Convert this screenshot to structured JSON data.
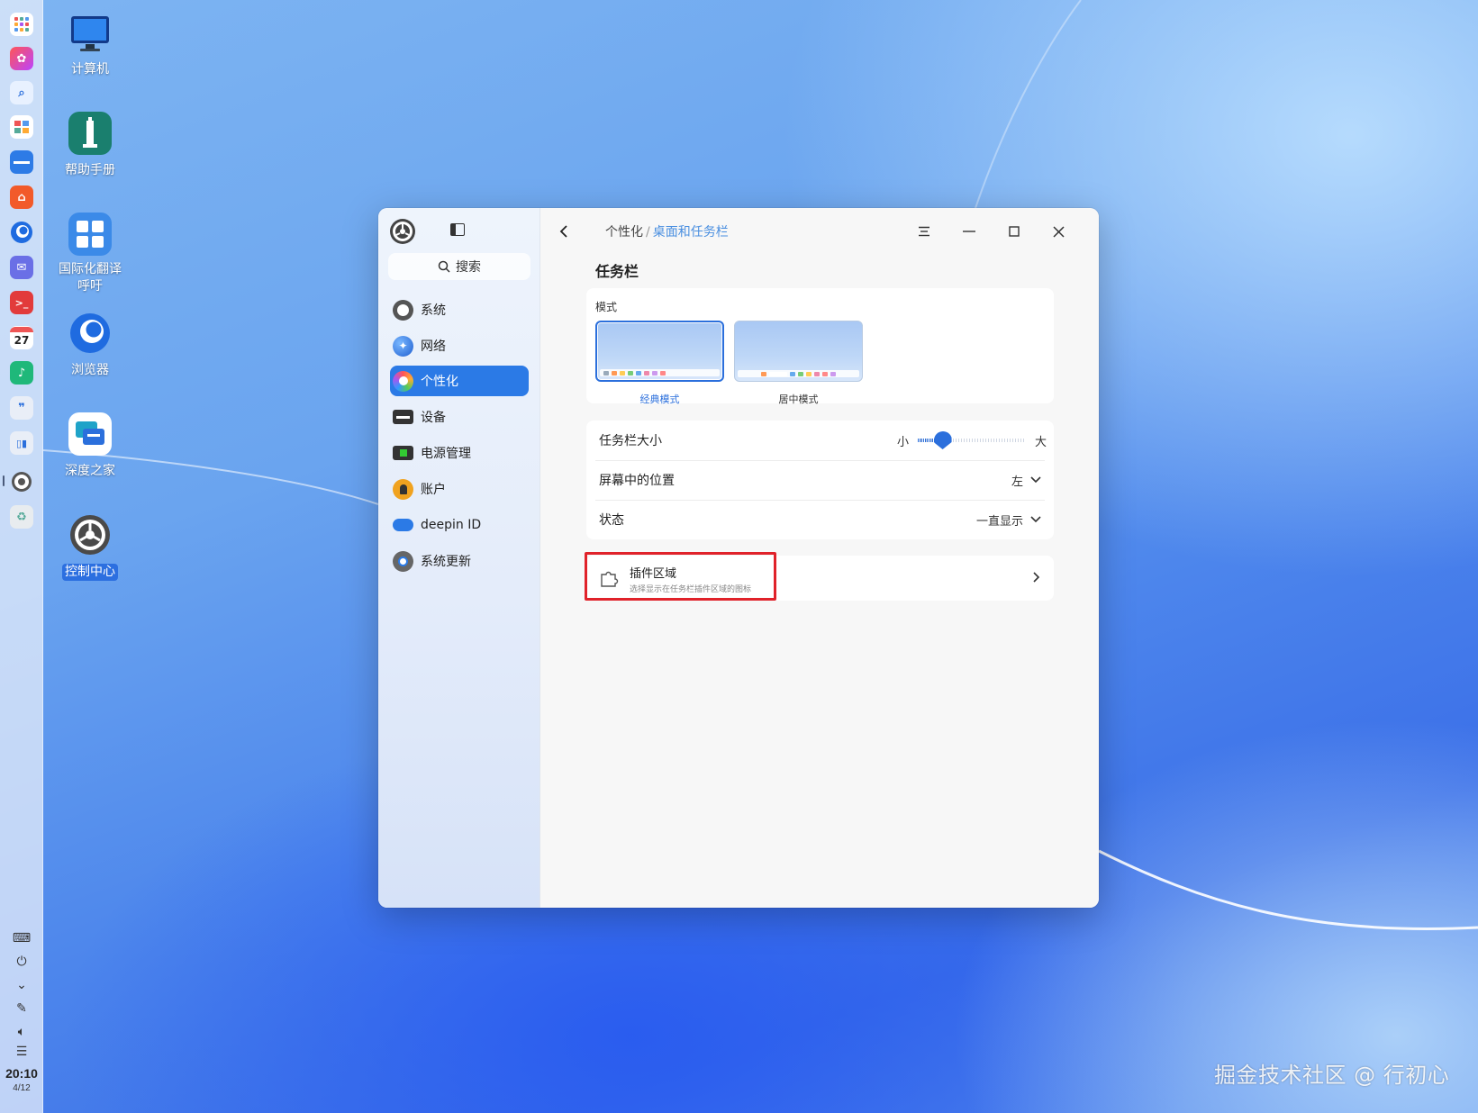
{
  "desktop": {
    "icons": [
      {
        "label": "计算机",
        "icon": "computer-icon"
      },
      {
        "label": "帮助手册",
        "icon": "lighthouse-help-icon"
      },
      {
        "label": "国际化翻译\n呼吁",
        "icon": "translate-icon"
      },
      {
        "label": "浏览器",
        "icon": "browser-icon"
      },
      {
        "label": "深度之家",
        "icon": "chat-icon"
      },
      {
        "label": "控制中心",
        "icon": "gear-icon"
      }
    ],
    "watermark": "掘金技术社区 @ 行初心"
  },
  "dock": {
    "apps": [
      "launcher-icon",
      "app-store-icon",
      "search-icon",
      "multitasking-icon",
      "file-manager-icon",
      "store-icon",
      "browser-icon",
      "mail-icon",
      "terminal-icon",
      "calendar-icon",
      "music-icon",
      "notes-icon",
      "phone-icon",
      "settings-icon",
      "trash-icon"
    ],
    "calendar_day": "27",
    "tray": [
      "keyboard-icon",
      "power-icon",
      "notification-icon",
      "pen-icon",
      "volume-icon",
      "storage-icon"
    ],
    "time": "20:10",
    "date": "4/12"
  },
  "window": {
    "sidebar": {
      "search_placeholder": "搜索",
      "items": [
        {
          "label": "系统",
          "icon": "system-icon"
        },
        {
          "label": "网络",
          "icon": "network-icon"
        },
        {
          "label": "个性化",
          "icon": "personalization-icon",
          "active": true
        },
        {
          "label": "设备",
          "icon": "device-icon"
        },
        {
          "label": "电源管理",
          "icon": "power-management-icon"
        },
        {
          "label": "账户",
          "icon": "account-icon"
        },
        {
          "label": "deepin ID",
          "icon": "cloud-icon"
        },
        {
          "label": "系统更新",
          "icon": "update-icon"
        }
      ]
    },
    "breadcrumb": {
      "parent": "个性化",
      "separator": "/",
      "current": "桌面和任务栏"
    },
    "section_title": "任务栏",
    "mode": {
      "label": "模式",
      "options": [
        {
          "name": "经典模式",
          "selected": true
        },
        {
          "name": "居中模式",
          "selected": false
        }
      ]
    },
    "taskbar_size": {
      "label": "任务栏大小",
      "min_label": "小",
      "max_label": "大",
      "value": 0.23
    },
    "position": {
      "label": "屏幕中的位置",
      "value": "左"
    },
    "state": {
      "label": "状态",
      "value": "一直显示"
    },
    "plugin_area": {
      "title": "插件区域",
      "description": "选择显示在任务栏插件区域的图标"
    },
    "colors": {
      "accent": "#2b7ae6",
      "highlight_border": "#e0222a"
    }
  }
}
